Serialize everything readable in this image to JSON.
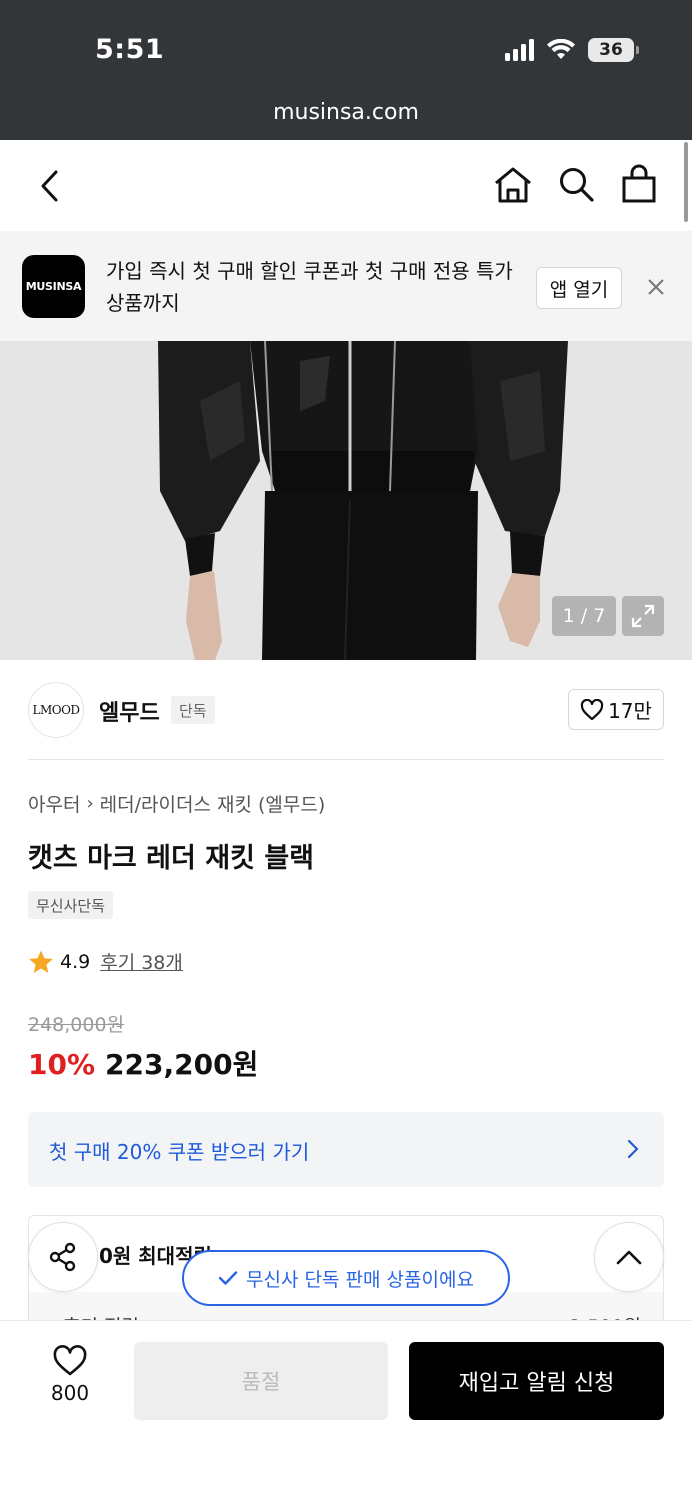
{
  "status_bar": {
    "time": "5:51",
    "battery": "36",
    "url": "musinsa.com"
  },
  "nav": {
    "back_icon": "chevron-left-icon",
    "home_icon": "home-icon",
    "search_icon": "search-icon",
    "bag_icon": "shopping-bag-icon"
  },
  "app_banner": {
    "logo_text": "MUSINSA",
    "message": "가입 즉시 첫 구매 할인 쿠폰과 첫 구매 전용 특가 상품까지",
    "open_app_label": "앱 열기"
  },
  "gallery": {
    "counter": "1 / 7"
  },
  "brand": {
    "logo_text": "LMOOD",
    "name": "엘무드",
    "badge": "단독",
    "likes": "17만"
  },
  "product": {
    "breadcrumb": [
      "아우터",
      "레더/라이더스 재킷 (엘무드)"
    ],
    "title": "캣츠 마크 레더 재킷 블랙",
    "tag": "무신사단독",
    "rating": "4.9",
    "reviews": "후기 38개",
    "original_price": "248,000원",
    "discount": "10%",
    "sale_price": "223,200원"
  },
  "coupon": {
    "label": "첫 구매 20% 쿠폰 받으러 가기"
  },
  "points": {
    "title": "0원 최대적립",
    "row_label": "후기 적립",
    "row_value": "2,500원"
  },
  "toast": {
    "text": "무신사 단독 판매 상품이에요"
  },
  "bottom_bar": {
    "wish_count": "800",
    "soldout_label": "품절",
    "restock_label": "재입고 알림 신청"
  },
  "colors": {
    "accent_blue": "#2a64e6",
    "discount_red": "#e02020",
    "status_bar": "#333639"
  }
}
